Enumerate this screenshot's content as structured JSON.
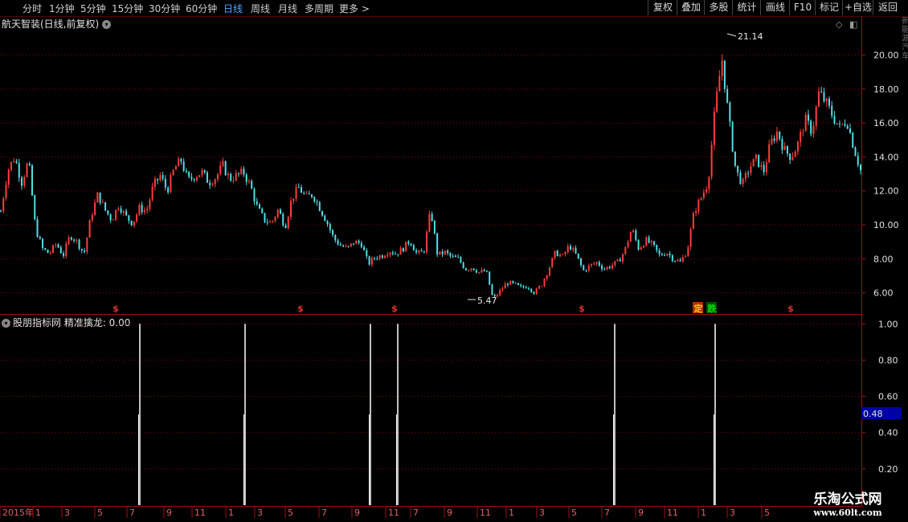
{
  "toolbar": {
    "periods": [
      "分时",
      "1分钟",
      "5分钟",
      "15分钟",
      "30分钟",
      "60分钟",
      "日线",
      "周线",
      "月线",
      "多周期",
      "更多 >"
    ],
    "active_period": "日线",
    "tools": [
      "复权",
      "叠加",
      "多股",
      "统计",
      "画线",
      "F10",
      "标记",
      "+自选",
      "返回"
    ]
  },
  "main_chart": {
    "title": "航天智装(日线,前复权)",
    "price_axis": [
      "20.00",
      "18.00",
      "16.00",
      "14.00",
      "12.00",
      "10.00",
      "8.00",
      "6.00"
    ],
    "high_label": "21.14",
    "low_label": "5.47",
    "event_markers": [
      {
        "label": "$",
        "color": "#e03030"
      },
      {
        "label": "$",
        "color": "#e03030"
      },
      {
        "label": "$",
        "color": "#e03030"
      },
      {
        "label": "$",
        "color": "#e03030"
      },
      {
        "label": "定",
        "color": "#ffcc00",
        "bg": "#b03000"
      },
      {
        "label": "跌",
        "color": "#00e000",
        "bg": "#005000"
      },
      {
        "label": "$",
        "color": "#e03030"
      }
    ]
  },
  "indicator": {
    "title": "股朋指标网  精准擒龙: 0.00",
    "axis": [
      "1.00",
      "0.80",
      "0.60",
      "0.40",
      "0.20"
    ],
    "current_value": "0.48"
  },
  "chart_data": {
    "type": "line",
    "title": "航天智装(日线,前复权)",
    "x_axis_ticks": [
      "2015年",
      "1",
      "3",
      "5",
      "7",
      "9",
      "11",
      "1",
      "3",
      "5",
      "7",
      "9",
      "11",
      "7",
      "9",
      "11",
      "1",
      "3",
      "5",
      "7",
      "9",
      "11",
      "1",
      "3",
      "5"
    ],
    "ylim": [
      4.8,
      22.2
    ],
    "series": [
      {
        "values": [
          10.8,
          13.2,
          14.0,
          12.5,
          13.8,
          9.8,
          8.6,
          8.3,
          8.9,
          8.2,
          9.4,
          9.0,
          8.3,
          10.5,
          11.8,
          10.9,
          10.3,
          11.2,
          10.5,
          10.1,
          11.0,
          10.8,
          12.3,
          12.9,
          12.0,
          13.3,
          13.8,
          12.6,
          12.9,
          13.1,
          12.5,
          12.8,
          13.5,
          12.7,
          12.9,
          13.1,
          12.3,
          11.0,
          10.3,
          10.1,
          10.9,
          9.9,
          11.6,
          12.2,
          11.6,
          11.8,
          11.0,
          10.2,
          9.2,
          8.8,
          8.6,
          9.0,
          8.9,
          7.7,
          8.1,
          8.2,
          8.5,
          8.3,
          8.6,
          9.1,
          8.3,
          8.4,
          10.9,
          8.2,
          8.4,
          8.1,
          8.0,
          7.4,
          7.5,
          7.2,
          7.3,
          5.6,
          6.1,
          6.6,
          6.5,
          6.3,
          6.4,
          6.0,
          6.5,
          7.4,
          8.4,
          8.1,
          8.8,
          8.2,
          7.3,
          7.6,
          7.8,
          7.4,
          7.6,
          7.8,
          8.5,
          9.8,
          8.6,
          9.1,
          8.8,
          8.2,
          8.4,
          8.0,
          7.8,
          8.5,
          10.8,
          11.6,
          12.5,
          16.8,
          19.8,
          16.2,
          13.2,
          12.4,
          13.4,
          13.9,
          13.1,
          14.8,
          15.5,
          14.4,
          14.0,
          14.8,
          16.2,
          15.5,
          17.8,
          17.2,
          16.4,
          15.7,
          16.2,
          14.6,
          13.2
        ]
      }
    ],
    "signal_ylim": [
      0,
      1.05
    ],
    "signals": [
      1.0,
      1.0,
      1.0,
      1.0,
      1.0,
      1.0
    ]
  },
  "watermark": {
    "name": "乐淘公式网",
    "url": "www.60lt.com"
  },
  "right_strip_text": "新能源汽车"
}
